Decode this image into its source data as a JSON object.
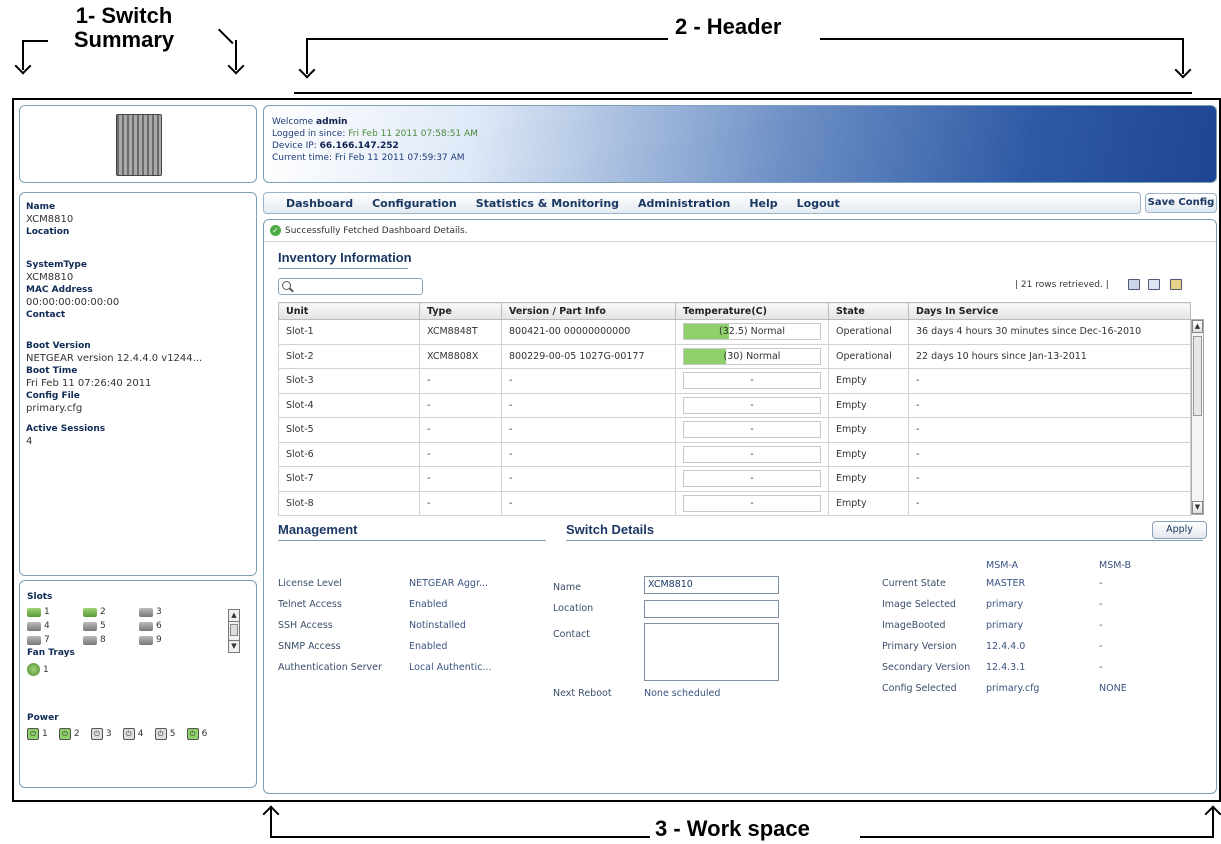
{
  "annotations": {
    "switch_summary": [
      "1- Switch",
      "Summary"
    ],
    "header": "2 - Header",
    "workspace": "3 - Work space"
  },
  "summary": {
    "name_label": "Name",
    "name": "XCM8810",
    "location_label": "Location",
    "location": "",
    "systemtype_label": "SystemType",
    "systemtype": "XCM8810",
    "mac_label": "MAC Address",
    "mac": "00:00:00:00:00:00",
    "contact_label": "Contact",
    "contact": "",
    "bootver_label": "Boot Version",
    "bootver": "NETGEAR version 12.4.4.0 v1244...",
    "boottime_label": "Boot Time",
    "boottime": "Fri Feb 11 07:26:40 2011",
    "config_label": "Config File",
    "config": "primary.cfg",
    "sessions_label": "Active Sessions",
    "sessions": "4"
  },
  "slots_panel": {
    "slots_label": "Slots",
    "slots": [
      "1",
      "2",
      "3",
      "4",
      "5",
      "6",
      "7",
      "8",
      "9"
    ],
    "fan_label": "Fan Trays",
    "fans": [
      "1"
    ],
    "power_label": "Power",
    "power": [
      "1",
      "2",
      "3",
      "4",
      "5",
      "6"
    ]
  },
  "header": {
    "welcome_prefix": "Welcome",
    "user": "admin",
    "logged_prefix": "Logged in since:",
    "logged_since": "Fri Feb 11 2011 07:58:51 AM",
    "ip_prefix": "Device IP:",
    "ip": "66.166.147.252",
    "time_prefix": "Current time:",
    "time": "Fri Feb 11 2011 07:59:37 AM"
  },
  "menu": {
    "items": [
      "Dashboard",
      "Configuration",
      "Statistics & Monitoring",
      "Administration",
      "Help",
      "Logout"
    ],
    "save": "Save Config"
  },
  "workspace": {
    "message": "Successfully Fetched Dashboard Details.",
    "inventory_title": "Inventory Information",
    "search_placeholder": "",
    "rows_info": "| 21 rows retrieved. |",
    "columns": [
      "Unit",
      "Type",
      "Version / Part Info",
      "Temperature(C)",
      "State",
      "Days In Service"
    ],
    "rows": [
      {
        "unit": "Slot-1",
        "type": "XCM8848T",
        "version": "800421-00 00000000000",
        "temp": "(32.5) Normal",
        "temp_pct": 0.33,
        "state": "Operational",
        "days": "36 days 4 hours 30 minutes  since Dec-16-2010"
      },
      {
        "unit": "Slot-2",
        "type": "XCM8808X",
        "version": "800229-00-05 1027G-00177",
        "temp": "(30) Normal",
        "temp_pct": 0.31,
        "state": "Operational",
        "days": "22 days 10 hours  since Jan-13-2011"
      },
      {
        "unit": "Slot-3",
        "type": "-",
        "version": "-",
        "temp": "-",
        "temp_pct": 0,
        "state": "Empty",
        "days": "-"
      },
      {
        "unit": "Slot-4",
        "type": "-",
        "version": "-",
        "temp": "-",
        "temp_pct": 0,
        "state": "Empty",
        "days": "-"
      },
      {
        "unit": "Slot-5",
        "type": "-",
        "version": "-",
        "temp": "-",
        "temp_pct": 0,
        "state": "Empty",
        "days": "-"
      },
      {
        "unit": "Slot-6",
        "type": "-",
        "version": "-",
        "temp": "-",
        "temp_pct": 0,
        "state": "Empty",
        "days": "-"
      },
      {
        "unit": "Slot-7",
        "type": "-",
        "version": "-",
        "temp": "-",
        "temp_pct": 0,
        "state": "Empty",
        "days": "-"
      },
      {
        "unit": "Slot-8",
        "type": "-",
        "version": "-",
        "temp": "-",
        "temp_pct": 0,
        "state": "Empty",
        "days": "-"
      }
    ],
    "management_title": "Management",
    "switch_details_title": "Switch Details",
    "apply": "Apply",
    "management": [
      {
        "label": "License Level",
        "value": "NETGEAR Aggr..."
      },
      {
        "label": "Telnet Access",
        "value": "Enabled"
      },
      {
        "label": "SSH Access",
        "value": "Notinstalled"
      },
      {
        "label": "SNMP Access",
        "value": "Enabled"
      },
      {
        "label": "Authentication Server",
        "value": "Local Authentic..."
      }
    ],
    "details": {
      "name_label": "Name",
      "name_value": "XCM8810",
      "location_label": "Location",
      "location_value": "",
      "contact_label": "Contact",
      "contact_value": "",
      "reboot_label": "Next Reboot",
      "reboot_value": "None scheduled"
    },
    "msm": {
      "col_a": "MSM-A",
      "col_b": "MSM-B",
      "rows": [
        {
          "label": "Current State",
          "a": "MASTER",
          "b": "-"
        },
        {
          "label": "Image Selected",
          "a": "primary",
          "b": "-"
        },
        {
          "label": "ImageBooted",
          "a": "primary",
          "b": "-"
        },
        {
          "label": "Primary Version",
          "a": "12.4.4.0",
          "b": "-"
        },
        {
          "label": "Secondary Version",
          "a": "12.4.3.1",
          "b": "-"
        },
        {
          "label": "Config Selected",
          "a": "primary.cfg",
          "b": "NONE"
        }
      ]
    }
  }
}
